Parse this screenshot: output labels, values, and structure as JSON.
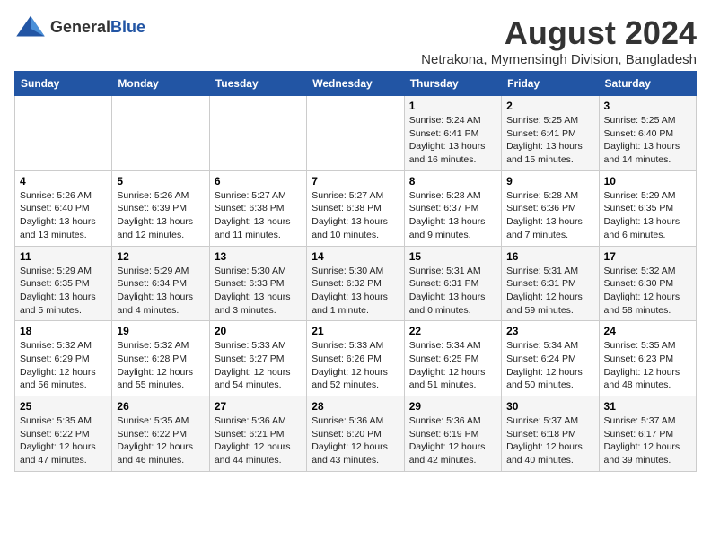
{
  "header": {
    "logo_general": "General",
    "logo_blue": "Blue",
    "title": "August 2024",
    "location": "Netrakona, Mymensingh Division, Bangladesh"
  },
  "days_of_week": [
    "Sunday",
    "Monday",
    "Tuesday",
    "Wednesday",
    "Thursday",
    "Friday",
    "Saturday"
  ],
  "weeks": [
    [
      {
        "day": "",
        "sunrise": "",
        "sunset": "",
        "daylight": ""
      },
      {
        "day": "",
        "sunrise": "",
        "sunset": "",
        "daylight": ""
      },
      {
        "day": "",
        "sunrise": "",
        "sunset": "",
        "daylight": ""
      },
      {
        "day": "",
        "sunrise": "",
        "sunset": "",
        "daylight": ""
      },
      {
        "day": "1",
        "sunrise": "5:24 AM",
        "sunset": "6:41 PM",
        "daylight": "13 hours and 16 minutes."
      },
      {
        "day": "2",
        "sunrise": "5:25 AM",
        "sunset": "6:41 PM",
        "daylight": "13 hours and 15 minutes."
      },
      {
        "day": "3",
        "sunrise": "5:25 AM",
        "sunset": "6:40 PM",
        "daylight": "13 hours and 14 minutes."
      }
    ],
    [
      {
        "day": "4",
        "sunrise": "5:26 AM",
        "sunset": "6:40 PM",
        "daylight": "13 hours and 13 minutes."
      },
      {
        "day": "5",
        "sunrise": "5:26 AM",
        "sunset": "6:39 PM",
        "daylight": "13 hours and 12 minutes."
      },
      {
        "day": "6",
        "sunrise": "5:27 AM",
        "sunset": "6:38 PM",
        "daylight": "13 hours and 11 minutes."
      },
      {
        "day": "7",
        "sunrise": "5:27 AM",
        "sunset": "6:38 PM",
        "daylight": "13 hours and 10 minutes."
      },
      {
        "day": "8",
        "sunrise": "5:28 AM",
        "sunset": "6:37 PM",
        "daylight": "13 hours and 9 minutes."
      },
      {
        "day": "9",
        "sunrise": "5:28 AM",
        "sunset": "6:36 PM",
        "daylight": "13 hours and 7 minutes."
      },
      {
        "day": "10",
        "sunrise": "5:29 AM",
        "sunset": "6:35 PM",
        "daylight": "13 hours and 6 minutes."
      }
    ],
    [
      {
        "day": "11",
        "sunrise": "5:29 AM",
        "sunset": "6:35 PM",
        "daylight": "13 hours and 5 minutes."
      },
      {
        "day": "12",
        "sunrise": "5:29 AM",
        "sunset": "6:34 PM",
        "daylight": "13 hours and 4 minutes."
      },
      {
        "day": "13",
        "sunrise": "5:30 AM",
        "sunset": "6:33 PM",
        "daylight": "13 hours and 3 minutes."
      },
      {
        "day": "14",
        "sunrise": "5:30 AM",
        "sunset": "6:32 PM",
        "daylight": "13 hours and 1 minute."
      },
      {
        "day": "15",
        "sunrise": "5:31 AM",
        "sunset": "6:31 PM",
        "daylight": "13 hours and 0 minutes."
      },
      {
        "day": "16",
        "sunrise": "5:31 AM",
        "sunset": "6:31 PM",
        "daylight": "12 hours and 59 minutes."
      },
      {
        "day": "17",
        "sunrise": "5:32 AM",
        "sunset": "6:30 PM",
        "daylight": "12 hours and 58 minutes."
      }
    ],
    [
      {
        "day": "18",
        "sunrise": "5:32 AM",
        "sunset": "6:29 PM",
        "daylight": "12 hours and 56 minutes."
      },
      {
        "day": "19",
        "sunrise": "5:32 AM",
        "sunset": "6:28 PM",
        "daylight": "12 hours and 55 minutes."
      },
      {
        "day": "20",
        "sunrise": "5:33 AM",
        "sunset": "6:27 PM",
        "daylight": "12 hours and 54 minutes."
      },
      {
        "day": "21",
        "sunrise": "5:33 AM",
        "sunset": "6:26 PM",
        "daylight": "12 hours and 52 minutes."
      },
      {
        "day": "22",
        "sunrise": "5:34 AM",
        "sunset": "6:25 PM",
        "daylight": "12 hours and 51 minutes."
      },
      {
        "day": "23",
        "sunrise": "5:34 AM",
        "sunset": "6:24 PM",
        "daylight": "12 hours and 50 minutes."
      },
      {
        "day": "24",
        "sunrise": "5:35 AM",
        "sunset": "6:23 PM",
        "daylight": "12 hours and 48 minutes."
      }
    ],
    [
      {
        "day": "25",
        "sunrise": "5:35 AM",
        "sunset": "6:22 PM",
        "daylight": "12 hours and 47 minutes."
      },
      {
        "day": "26",
        "sunrise": "5:35 AM",
        "sunset": "6:22 PM",
        "daylight": "12 hours and 46 minutes."
      },
      {
        "day": "27",
        "sunrise": "5:36 AM",
        "sunset": "6:21 PM",
        "daylight": "12 hours and 44 minutes."
      },
      {
        "day": "28",
        "sunrise": "5:36 AM",
        "sunset": "6:20 PM",
        "daylight": "12 hours and 43 minutes."
      },
      {
        "day": "29",
        "sunrise": "5:36 AM",
        "sunset": "6:19 PM",
        "daylight": "12 hours and 42 minutes."
      },
      {
        "day": "30",
        "sunrise": "5:37 AM",
        "sunset": "6:18 PM",
        "daylight": "12 hours and 40 minutes."
      },
      {
        "day": "31",
        "sunrise": "5:37 AM",
        "sunset": "6:17 PM",
        "daylight": "12 hours and 39 minutes."
      }
    ]
  ]
}
